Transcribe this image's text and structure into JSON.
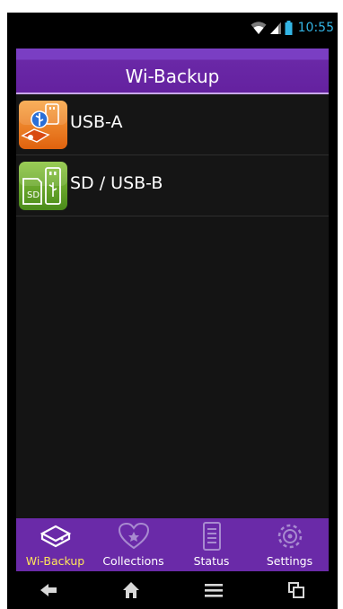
{
  "status_bar": {
    "time": "10:55",
    "wifi_icon": "wifi-icon",
    "signal_icon": "signal-icon",
    "battery_icon": "battery-icon",
    "time_color": "#33b5e5"
  },
  "header": {
    "title": "Wi-Backup"
  },
  "storage_list": [
    {
      "label": "USB-A",
      "icon": "usb-drive-icon"
    },
    {
      "label": "SD / USB-B",
      "icon": "sd-usb-icon"
    }
  ],
  "tabs": [
    {
      "label": "Wi-Backup",
      "icon": "hard-drive-icon",
      "active": true
    },
    {
      "label": "Collections",
      "icon": "heart-icon",
      "active": false
    },
    {
      "label": "Status",
      "icon": "status-list-icon",
      "active": false
    },
    {
      "label": "Settings",
      "icon": "gear-icon",
      "active": false
    }
  ],
  "nav": {
    "back": "back-icon",
    "home": "home-icon",
    "menu": "menu-icon",
    "recents": "recent-apps-icon"
  },
  "colors": {
    "accent_purple": "#6a2aa8",
    "active_tab_text": "#ffe55a",
    "usb_icon_orange": "#f07c1a",
    "sd_icon_green": "#6aa82a"
  }
}
